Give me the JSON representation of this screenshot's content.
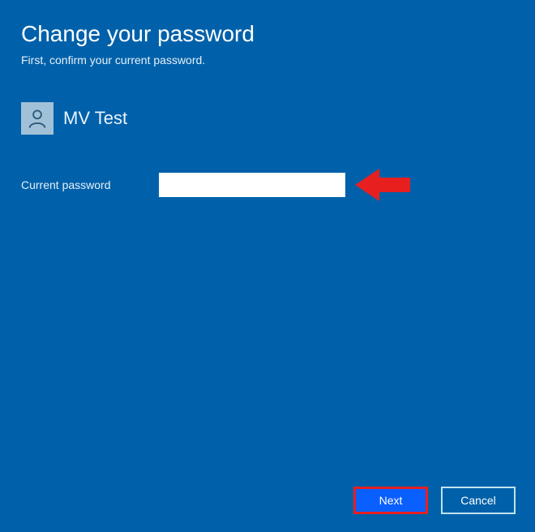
{
  "header": {
    "title": "Change your password",
    "subtitle": "First, confirm your current password."
  },
  "user": {
    "name": "MV Test"
  },
  "form": {
    "current_password_label": "Current password",
    "current_password_value": ""
  },
  "buttons": {
    "next": "Next",
    "cancel": "Cancel"
  },
  "colors": {
    "background": "#0061aa",
    "accent_next": "#0a5fff",
    "annotation_red": "#e81f1f"
  }
}
